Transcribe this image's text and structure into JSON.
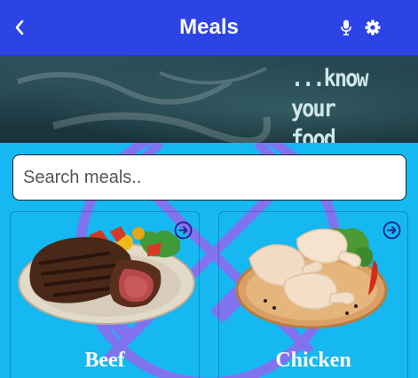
{
  "appbar": {
    "title": "Meals",
    "background": "#2c44e6",
    "back_icon": "chevron-left-icon",
    "mic_icon": "microphone-icon",
    "settings_icon": "gear-icon"
  },
  "banner": {
    "tagline": "...know your\nfood"
  },
  "search": {
    "placeholder": "Search meals..",
    "value": ""
  },
  "meals": [
    {
      "label": "Beef",
      "icon": "arrow-right-circle-icon"
    },
    {
      "label": "Chicken",
      "icon": "arrow-right-circle-icon"
    }
  ],
  "colors": {
    "background": "#15b8f0",
    "accent": "#2c44e6",
    "deco": "#8d6cf0"
  }
}
